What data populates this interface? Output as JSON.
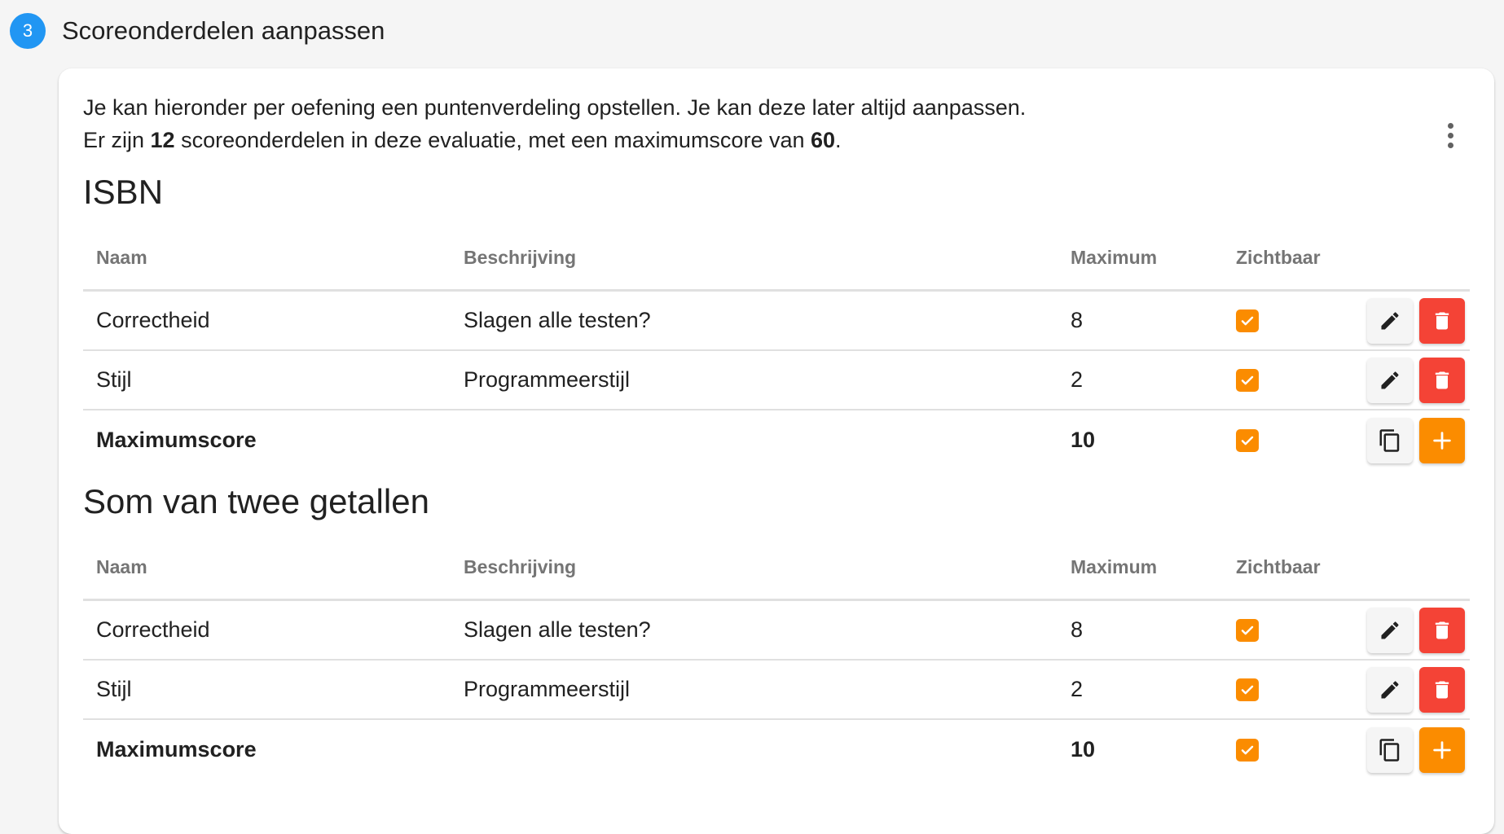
{
  "step": {
    "number": "3",
    "title": "Scoreonderdelen aanpassen"
  },
  "intro": {
    "line1": "Je kan hieronder per oefening een puntenverdeling opstellen. Je kan deze later altijd aanpassen.",
    "line2_prefix": "Er zijn ",
    "line2_count": "12",
    "line2_middle": " scoreonderdelen in deze evaluatie, met een maximumscore van ",
    "line2_max": "60",
    "line2_suffix": "."
  },
  "headers": {
    "naam": "Naam",
    "beschrijving": "Beschrijving",
    "maximum": "Maximum",
    "zichtbaar": "Zichtbaar"
  },
  "sections": [
    {
      "title": "ISBN",
      "rows": [
        {
          "naam": "Correctheid",
          "beschrijving": "Slagen alle testen?",
          "maximum": "8"
        },
        {
          "naam": "Stijl",
          "beschrijving": "Programmeerstijl",
          "maximum": "2"
        }
      ],
      "total": {
        "label": "Maximumscore",
        "maximum": "10"
      }
    },
    {
      "title": "Som van twee getallen",
      "rows": [
        {
          "naam": "Correctheid",
          "beschrijving": "Slagen alle testen?",
          "maximum": "8"
        },
        {
          "naam": "Stijl",
          "beschrijving": "Programmeerstijl",
          "maximum": "2"
        }
      ],
      "total": {
        "label": "Maximumscore",
        "maximum": "10"
      }
    }
  ],
  "colors": {
    "accent": "#2196f3",
    "checkbox": "#fb8c00",
    "delete": "#f44336",
    "add": "#fb8c00"
  },
  "icons": {
    "edit": "pencil-icon",
    "delete": "trash-icon",
    "copy": "copy-icon",
    "add": "plus-icon",
    "menu": "more-vert-icon",
    "check": "check-icon"
  }
}
